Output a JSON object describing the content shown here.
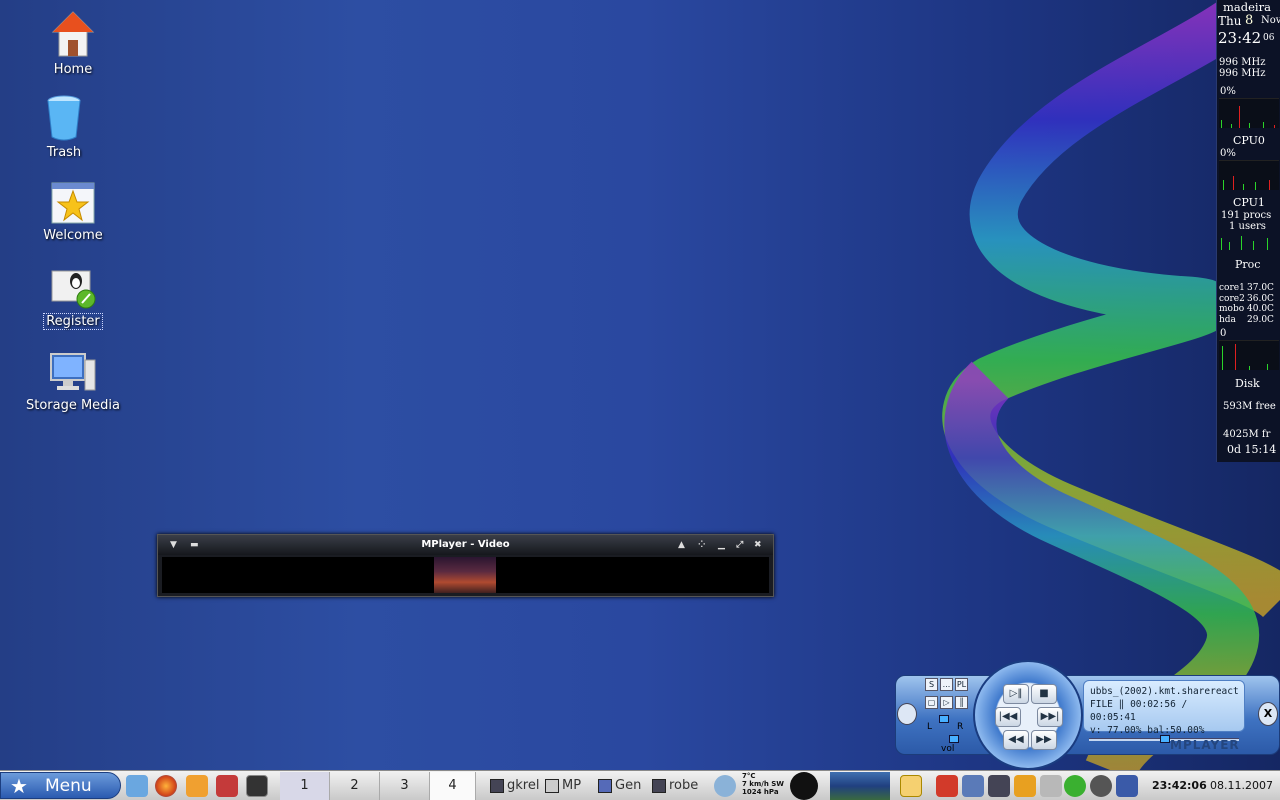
{
  "desktop_icons": [
    {
      "label": "Home",
      "icon": "home-icon"
    },
    {
      "label": "Trash",
      "icon": "trash-icon"
    },
    {
      "label": "Welcome",
      "icon": "welcome-star-icon"
    },
    {
      "label": "Register",
      "icon": "register-tux-icon"
    },
    {
      "label": "Storage Media",
      "icon": "storage-media-icon"
    }
  ],
  "gkrellm": {
    "host": "madeira",
    "day": "Thu",
    "date_num": "8",
    "month": "Nov",
    "time": "23:42",
    "seconds": "06",
    "freq1": "996 MHz",
    "freq2": "996 MHz",
    "cpu_pct": "0%",
    "cpu0_label": "CPU0",
    "cpu0_pct": "0%",
    "cpu1_label": "CPU1",
    "procs": "191 procs",
    "users": "1 users",
    "proc_label": "Proc",
    "sensors": [
      {
        "name": "core1",
        "val": "37.0C"
      },
      {
        "name": "core2",
        "val": "36.0C"
      },
      {
        "name": "mobo",
        "val": "40.0C"
      },
      {
        "name": "hda",
        "val": "29.0C"
      }
    ],
    "disk_val": "0",
    "disk_label": "Disk",
    "free1": "593M free",
    "free2": "4025M fr",
    "uptime": "0d 15:14"
  },
  "video_window": {
    "title": "MPlayer - Video"
  },
  "mplayer": {
    "filename": "ubbs_(2002).kmt.sharereact",
    "file_label": "FILE",
    "time": "00:02:56 / 00:05:41",
    "volume": "v: 77.00%",
    "balance": "bal:50.00%",
    "brand": "MPLAYER",
    "vol_label": "vol",
    "left": "L",
    "right": "R",
    "close": "X",
    "small_buttons": [
      "S",
      "...",
      "PL"
    ],
    "progress": 0.51
  },
  "taskbar": {
    "menu_label": "Menu",
    "desktops": [
      "1",
      "2",
      "3",
      "4"
    ],
    "tasks": [
      "gkrel",
      "MP",
      "Gen",
      "robe"
    ],
    "weather": {
      "temp": "7°C",
      "wind": "7 km/h SW",
      "pressure": "1024 hPa"
    },
    "clock": "23:42:06",
    "date": "08.11.2007"
  }
}
